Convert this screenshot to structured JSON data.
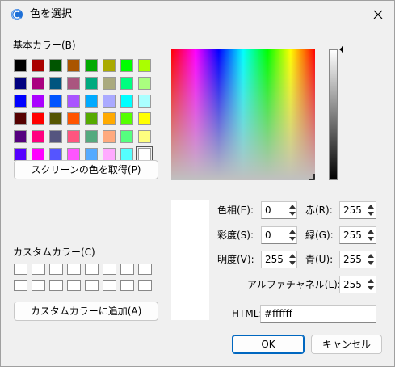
{
  "title": "色を選択",
  "basic_colors_label": "基本カラー(B)",
  "custom_colors_label": "カスタムカラー(C)",
  "pick_screen_button": "スクリーンの色を取得(P)",
  "add_custom_button": "カスタムカラーに追加(A)",
  "fields": {
    "hue": {
      "label": "色相(E):",
      "value": "0"
    },
    "sat": {
      "label": "彩度(S):",
      "value": "0"
    },
    "lum": {
      "label": "明度(V):",
      "value": "255"
    },
    "red": {
      "label": "赤(R):",
      "value": "255"
    },
    "green": {
      "label": "緑(G):",
      "value": "255"
    },
    "blue": {
      "label": "青(U):",
      "value": "255"
    },
    "alpha": {
      "label": "アルファチャネル(L):",
      "value": "255"
    }
  },
  "html_label": "HTML:",
  "html_value": "#ffffff",
  "ok_button": "OK",
  "cancel_button": "キャンセル",
  "basic_colors": [
    "#000000",
    "#aa0000",
    "#005500",
    "#aa5500",
    "#00aa00",
    "#aaaa00",
    "#00ff00",
    "#aaff00",
    "#00007f",
    "#aa007f",
    "#00557f",
    "#aa557f",
    "#00aa7f",
    "#aaaa7f",
    "#00ff7f",
    "#aaff7f",
    "#0000ff",
    "#aa00ff",
    "#0055ff",
    "#aa55ff",
    "#00aaff",
    "#aaaaff",
    "#00ffff",
    "#aaffff",
    "#550000",
    "#ff0000",
    "#555500",
    "#ff5500",
    "#55aa00",
    "#ffaa00",
    "#55ff00",
    "#ffff00",
    "#55007f",
    "#ff007f",
    "#55557f",
    "#ff557f",
    "#55aa7f",
    "#ffaa7f",
    "#55ff7f",
    "#ffff7f",
    "#5500ff",
    "#ff00ff",
    "#5555ff",
    "#ff55ff",
    "#55aaff",
    "#ffaaff",
    "#55ffff",
    "#ffffff"
  ],
  "accent": "#0067c0"
}
